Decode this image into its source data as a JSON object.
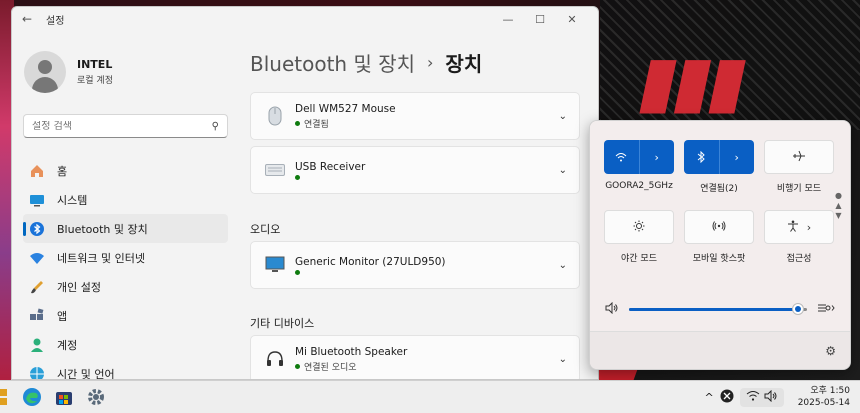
{
  "window": {
    "title": "설정",
    "back_glyph": "←",
    "minimize_glyph": "—",
    "maximize_glyph": "☐",
    "close_glyph": "✕"
  },
  "profile": {
    "name": "INTEL",
    "subtitle": "로컬 계정"
  },
  "search": {
    "placeholder": "설정 검색"
  },
  "nav": [
    {
      "label": "홈",
      "icon": "home-icon"
    },
    {
      "label": "시스템",
      "icon": "monitor-icon"
    },
    {
      "label": "Bluetooth 및 장치",
      "icon": "bluetooth-icon"
    },
    {
      "label": "네트워크 및 인터넷",
      "icon": "wifi-icon"
    },
    {
      "label": "개인 설정",
      "icon": "brush-icon"
    },
    {
      "label": "앱",
      "icon": "apps-icon"
    },
    {
      "label": "계정",
      "icon": "person-icon"
    },
    {
      "label": "시간 및 언어",
      "icon": "globe-icon"
    }
  ],
  "breadcrumb": {
    "parent": "Bluetooth 및 장치",
    "separator": "›",
    "current": "장치"
  },
  "devices": [
    {
      "name": "Dell WM527 Mouse",
      "status": "연결됨",
      "icon": "mouse-icon"
    },
    {
      "name": "USB Receiver",
      "status": "",
      "icon": "keyboard-icon"
    }
  ],
  "audio_section": {
    "title": "오디오",
    "devices": [
      {
        "name": "Generic Monitor (27ULD950)",
        "status": "",
        "icon": "monitor-icon"
      }
    ]
  },
  "other_section": {
    "title": "기타 디바이스",
    "devices": [
      {
        "name": "Mi Bluetooth Speaker",
        "status": "연결된 오디오",
        "icon": "headphones-icon"
      }
    ]
  },
  "quick_settings": {
    "tiles": [
      {
        "label": "GOORA2_5GHz",
        "icon": "wifi-icon",
        "active": true,
        "has_arrow": true
      },
      {
        "label": "연결됨(2)",
        "icon": "bluetooth-icon",
        "active": true,
        "has_arrow": true
      },
      {
        "label": "비행기 모드",
        "icon": "airplane-icon",
        "active": false,
        "has_arrow": false
      },
      {
        "label": "야간 모드",
        "icon": "brightness-icon",
        "active": false,
        "has_arrow": false
      },
      {
        "label": "모바일 핫스팟",
        "icon": "hotspot-icon",
        "active": false,
        "has_arrow": false
      },
      {
        "label": "접근성",
        "icon": "accessibility-icon",
        "active": false,
        "has_arrow": true
      }
    ],
    "volume": {
      "level": 0.95
    },
    "arrow_glyph": "›",
    "gear_glyph": "⚙"
  },
  "taskbar": {
    "apps": [
      "edge-icon",
      "store-icon",
      "settings-icon"
    ],
    "tray_chevron": "^",
    "time": "오후 1:50",
    "date": "2025-05-14"
  },
  "colors": {
    "accent": "#0a5fc4",
    "status_green": "#0f7b0f"
  }
}
